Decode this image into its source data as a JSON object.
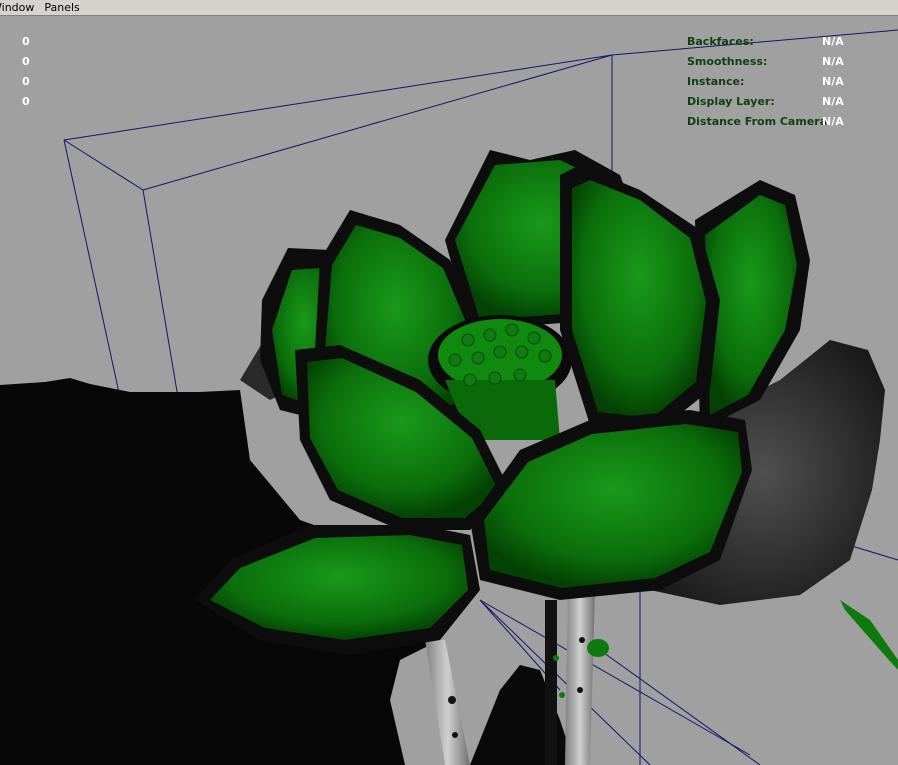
{
  "menubar": {
    "items": [
      {
        "label": "Window"
      },
      {
        "label": "Panels"
      }
    ]
  },
  "hud_left": {
    "values": [
      "0",
      "0",
      "0",
      "0"
    ]
  },
  "hud_right": {
    "rows": [
      {
        "label": "Backfaces:",
        "value": "N/A"
      },
      {
        "label": "Smoothness:",
        "value": "N/A"
      },
      {
        "label": "Instance:",
        "value": "N/A"
      },
      {
        "label": "Display Layer:",
        "value": "N/A"
      },
      {
        "label": "Distance From Camera:",
        "value": "N/A"
      }
    ]
  },
  "colors": {
    "viewport_bg": "#a0a0a0",
    "petal_green": "#0e7a0e",
    "petal_dark_green": "#064a06",
    "outline_black": "#0a0a0a",
    "leaf_gray": "#3a3a3a",
    "wireframe_blue": "#14146e",
    "stem_gray": "#b4b4b4",
    "hud_label_green": "#104010"
  }
}
